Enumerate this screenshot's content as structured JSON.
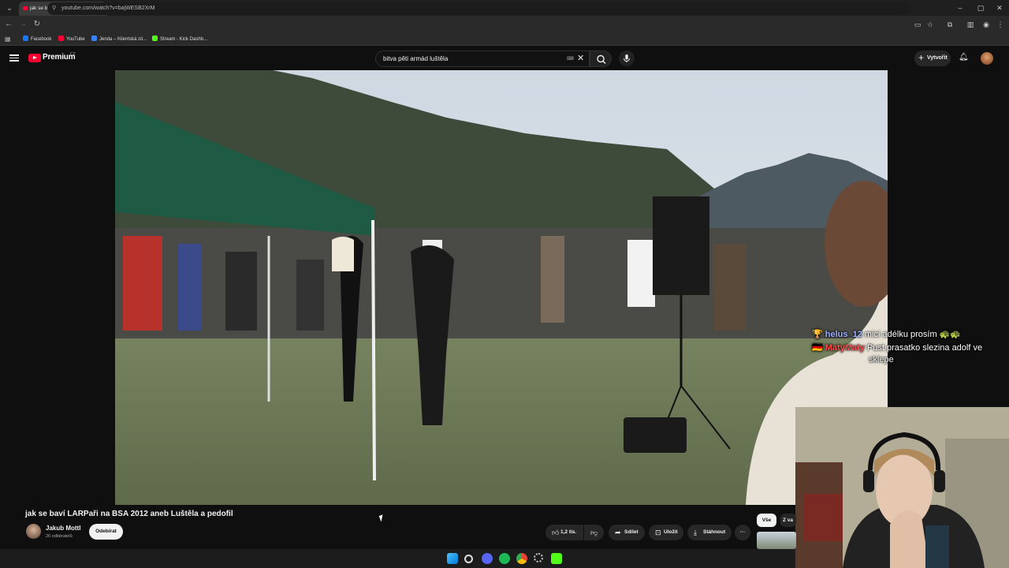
{
  "browser": {
    "tab_title": "jak se baví LARPaři na BSA",
    "tab_close": "×",
    "new_tab": "+",
    "url": "youtube.com/watch?v=bajWESB2XrM",
    "bookmarks": [
      {
        "label": "Facebook",
        "color": "#1877f2"
      },
      {
        "label": "YouTube",
        "color": "#ff0033"
      },
      {
        "label": "Jenda – Klientská zó...",
        "color": "#3b82f6"
      },
      {
        "label": "Stream - Kick Dashb...",
        "color": "#53fc18"
      }
    ],
    "window_controls": [
      "–",
      "▢",
      "✕"
    ]
  },
  "youtube": {
    "logo_text": "Premium",
    "logo_country": "CZ",
    "search_value": "bitva pěti armád luštěla",
    "create_label": "Vytvořit",
    "accent": "#ff0033"
  },
  "video": {
    "title": "jak se baví LARPaři na BSA 2012 aneb Luštěla a pedofil",
    "channel": "Jakub Mottl",
    "subscribers": "26 odběratelů",
    "subscribe_label": "Odebírat",
    "like_count": "1,2 tis.",
    "share_label": "Sdílet",
    "save_label": "Uložit",
    "download_label": "Stáhnout",
    "more_label": "···"
  },
  "chat": [
    {
      "user": "helus_12",
      "badge": "🏆",
      "text": "mici adélku prosím 🐢🐢"
    },
    {
      "user": "MatyMaty",
      "badge": "🇩🇪",
      "text": "Pust prasatko slezina adolf ve",
      "text2": "sklepe"
    }
  ],
  "sidebar": {
    "chips": [
      "Vše",
      "Z va"
    ]
  }
}
